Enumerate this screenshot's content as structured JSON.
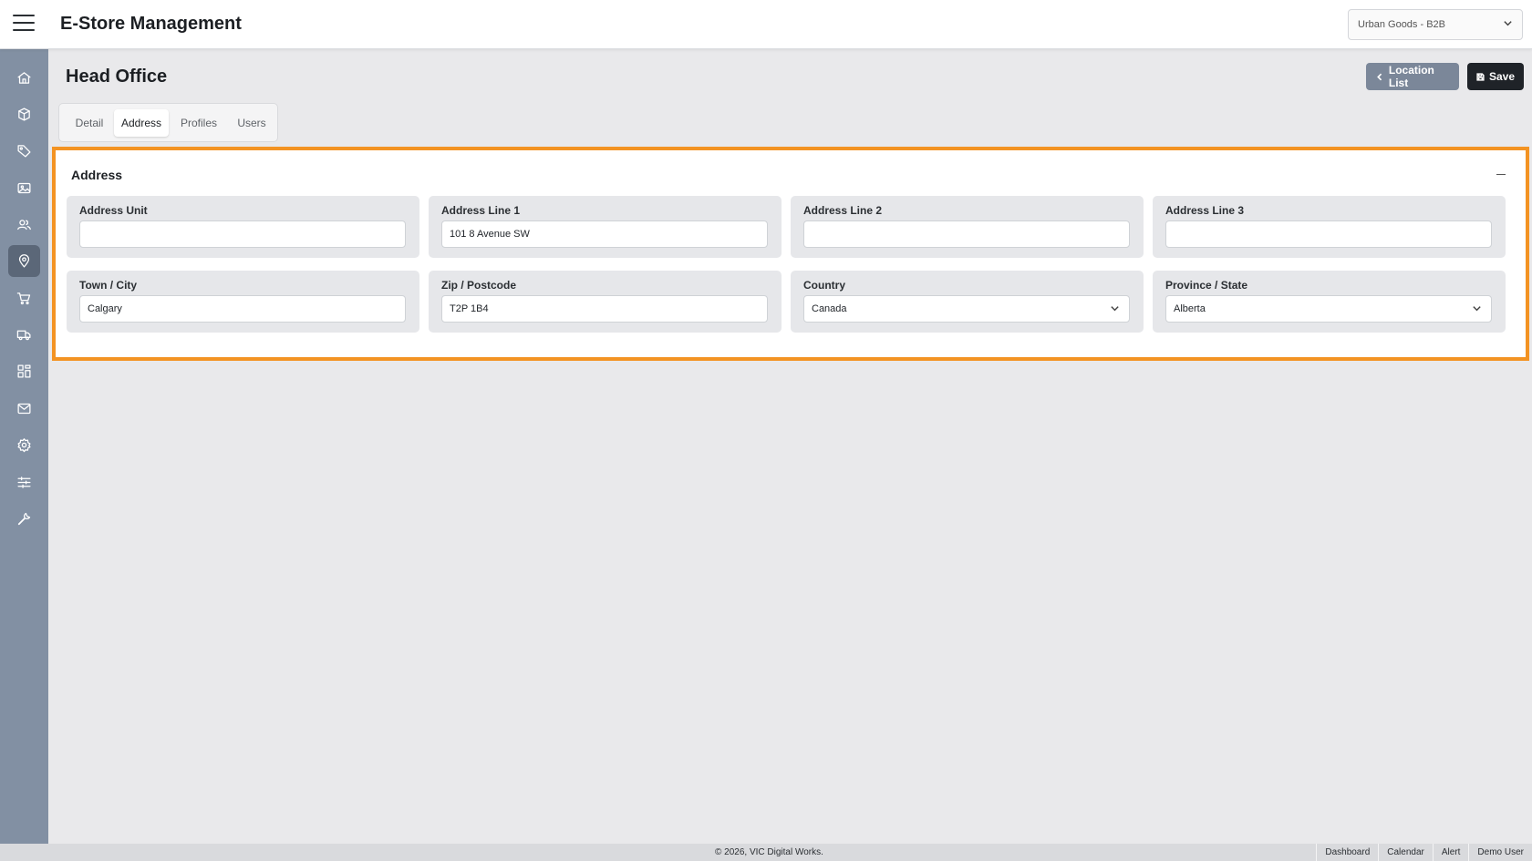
{
  "header": {
    "app_title": "E-Store Management",
    "store_selector": {
      "value": "Urban Goods - B2B",
      "icon": "chevron-down-icon"
    }
  },
  "sidebar": {
    "items": [
      {
        "name": "home",
        "icon": "home-icon"
      },
      {
        "name": "products",
        "icon": "box-icon"
      },
      {
        "name": "pricing",
        "icon": "tag-icon"
      },
      {
        "name": "media",
        "icon": "image-icon"
      },
      {
        "name": "customers",
        "icon": "users-icon"
      },
      {
        "name": "locations",
        "icon": "map-pin-icon",
        "active": true
      },
      {
        "name": "orders",
        "icon": "cart-icon"
      },
      {
        "name": "shipping",
        "icon": "truck-icon"
      },
      {
        "name": "widgets",
        "icon": "grid-icon"
      },
      {
        "name": "messages",
        "icon": "mail-icon"
      },
      {
        "name": "settings",
        "icon": "gear-icon"
      },
      {
        "name": "filters",
        "icon": "sliders-icon"
      },
      {
        "name": "tools",
        "icon": "wrench-icon"
      }
    ]
  },
  "page": {
    "title": "Head Office",
    "location_list_label": "Location List",
    "save_label": "Save",
    "tabs": [
      {
        "label": "Detail"
      },
      {
        "label": "Address",
        "active": true
      },
      {
        "label": "Profiles"
      },
      {
        "label": "Users"
      }
    ]
  },
  "address": {
    "title": "Address",
    "fields": [
      {
        "label": "Address Unit",
        "value": ""
      },
      {
        "label": "Address Line 1",
        "value": "101 8 Avenue SW"
      },
      {
        "label": "Address Line 2",
        "value": ""
      },
      {
        "label": "Address Line 3",
        "value": ""
      },
      {
        "label": "Town / City",
        "value": "Calgary"
      },
      {
        "label": "Zip / Postcode",
        "value": "T2P 1B4"
      },
      {
        "label": "Country",
        "value": "Canada"
      },
      {
        "label": "Province / State",
        "value": "Alberta"
      }
    ]
  },
  "footer": {
    "copyright": "© 2026, VIC Digital Works.",
    "links": [
      {
        "label": "Dashboard"
      },
      {
        "label": "Calendar"
      },
      {
        "label": "Alert"
      },
      {
        "label": "Demo User"
      }
    ]
  },
  "colors": {
    "accent_highlight": "#f39323",
    "sidebar_bg": "#8290a3",
    "sidebar_active": "#5b6778",
    "save_button": "#1f2328",
    "location_button": "#7b8799"
  }
}
